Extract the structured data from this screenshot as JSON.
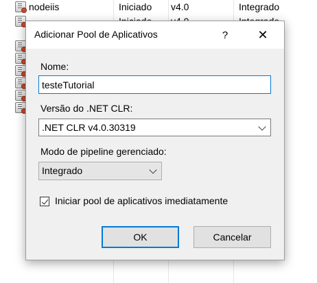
{
  "background_list": {
    "rows": [
      {
        "name": "nodeiis",
        "status": "Iniciado",
        "clr": "v4.0",
        "pipeline": "Integrado"
      },
      {
        "name": "",
        "status": "Iniciado",
        "clr": "v4.0",
        "pipeline": "Integrado"
      }
    ]
  },
  "dialog": {
    "title": "Adicionar Pool de Aplicativos",
    "help_label": "?",
    "close_label": "✕",
    "name_label": "Nome:",
    "name_value": "testeTutorial",
    "clr_label": "Versão do .NET CLR:",
    "clr_value": ".NET CLR v4.0.30319",
    "pipeline_label": "Modo de pipeline gerenciado:",
    "pipeline_value": "Integrado",
    "start_label": "Iniciar pool de aplicativos imediatamente",
    "start_checked": true,
    "ok_label": "OK",
    "cancel_label": "Cancelar"
  },
  "colors": {
    "accent": "#0078d7",
    "dialog_bg": "#f0f0f0"
  }
}
